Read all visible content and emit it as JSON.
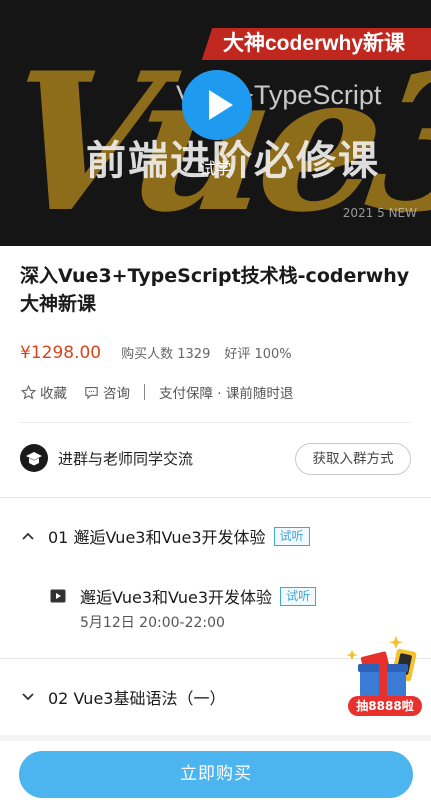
{
  "hero": {
    "brand_ribbon": "大神coderwhy新课",
    "big_logo": "Vue3",
    "subtitle": "Vue3+TypeScript",
    "banner_text": "前端进阶必修课",
    "date_badge": "2021 5 NEW",
    "trial_label": "试学"
  },
  "course": {
    "title": "深入Vue3+TypeScript技术栈-coderwhy大神新课",
    "price": "¥1298.00",
    "buyers_label": "购买人数 1329",
    "rating_label": "好评 100%"
  },
  "actions": {
    "favorite": "收藏",
    "consult": "咨询",
    "guarantee": "支付保障 · 课前随时退"
  },
  "group": {
    "label": "进群与老师同学交流",
    "button": "获取入群方式"
  },
  "chapters": [
    {
      "title": "01 邂逅Vue3和Vue3开发体验",
      "tag": "试听",
      "expanded": true,
      "lessons": [
        {
          "title": "邂逅Vue3和Vue3开发体验",
          "tag": "试听",
          "time": "5月12日 20:00-22:00"
        }
      ]
    },
    {
      "title": "02 Vue3基础语法（一）",
      "expanded": false
    }
  ],
  "lottery": {
    "label": "抽8888啦"
  },
  "buy_button": "立即购买",
  "colors": {
    "accent": "#4cb4ee",
    "price": "#d9441b",
    "play": "#1e9bf0",
    "tag": "#41a5d8"
  }
}
